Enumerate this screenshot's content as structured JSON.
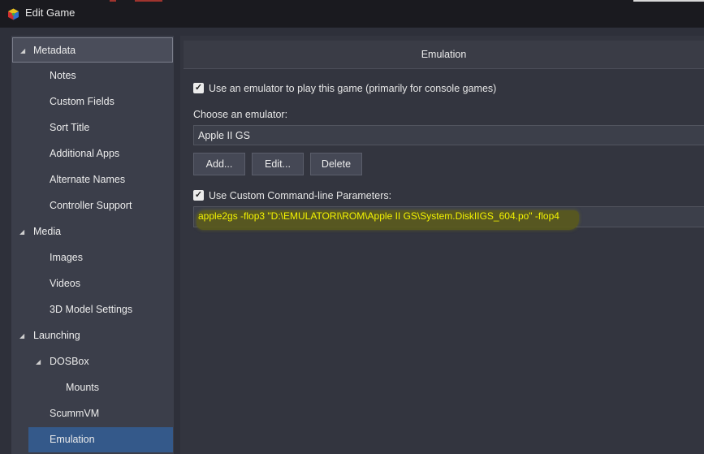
{
  "window": {
    "title": "Edit Game",
    "icon": "launchbox-cube-icon"
  },
  "sidebar": {
    "items": [
      {
        "label": "Metadata"
      },
      {
        "label": "Notes"
      },
      {
        "label": "Custom Fields"
      },
      {
        "label": "Sort Title"
      },
      {
        "label": "Additional Apps"
      },
      {
        "label": "Alternate Names"
      },
      {
        "label": "Controller Support"
      },
      {
        "label": "Media"
      },
      {
        "label": "Images"
      },
      {
        "label": "Videos"
      },
      {
        "label": "3D Model Settings"
      },
      {
        "label": "Launching"
      },
      {
        "label": "DOSBox"
      },
      {
        "label": "Mounts"
      },
      {
        "label": "ScummVM"
      },
      {
        "label": "Emulation"
      }
    ],
    "selected": "Emulation"
  },
  "main": {
    "header": "Emulation",
    "use_emulator": {
      "label": "Use an emulator to play this game (primarily for console games)",
      "checked": true
    },
    "choose_label": "Choose an emulator:",
    "emulator_value": "Apple II GS",
    "buttons": {
      "add": "Add...",
      "edit": "Edit...",
      "delete": "Delete"
    },
    "custom_params": {
      "label": "Use Custom Command-line Parameters:",
      "checked": true
    },
    "command_line": "apple2gs -flop3 \"D:\\EMULATORI\\ROM\\Apple II GS\\System.DiskIIGS_604.po\" -flop4"
  },
  "colors": {
    "accent": "#34598a",
    "highlight_text": "#f3f300",
    "window_bg": "#2e303a"
  }
}
